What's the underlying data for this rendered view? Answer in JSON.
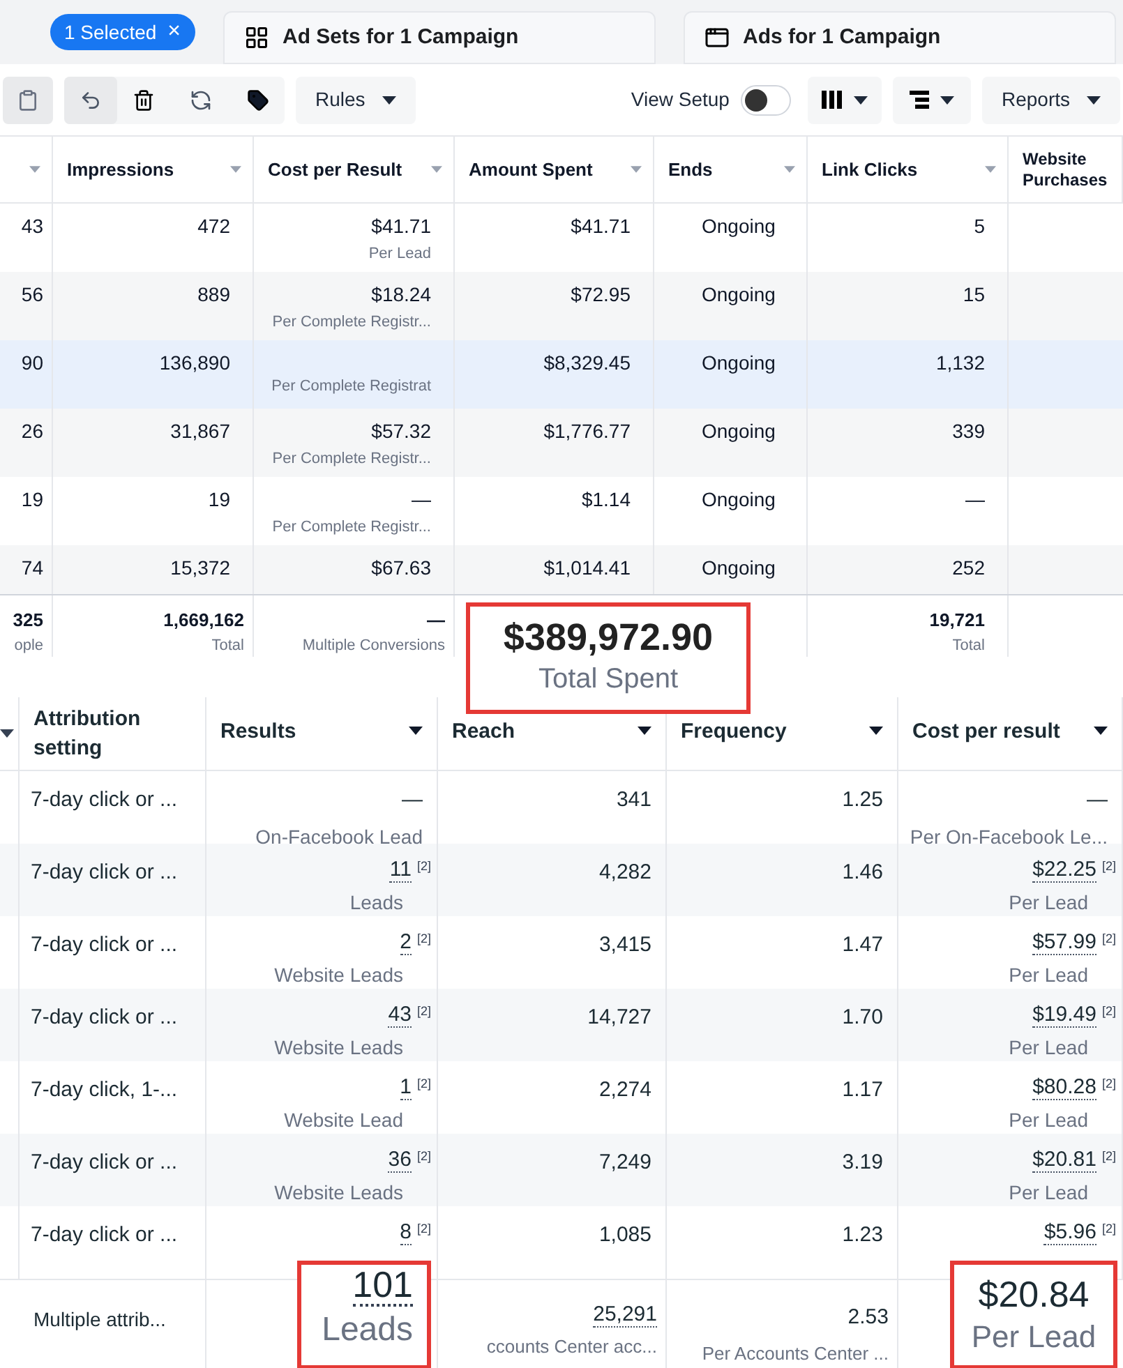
{
  "selection_chip": {
    "label": "1 Selected",
    "close": "×"
  },
  "tabs": [
    {
      "label": "Ad Sets for 1 Campaign",
      "kind": "adsets",
      "selected": false
    },
    {
      "label": "Ads for 1 Campaign",
      "kind": "ads",
      "selected": false
    }
  ],
  "toolbar": {
    "rules": "Rules",
    "view_setup": {
      "label": "View Setup",
      "on": false
    },
    "reports": "Reports"
  },
  "top_table": {
    "columns": [
      "",
      "Impressions",
      "Cost per Result",
      "Amount Spent",
      "Ends",
      "Link Clicks",
      "Website Purchases"
    ],
    "rows": [
      {
        "selected": false,
        "cells": [
          {
            "value": "43"
          },
          {
            "value": "472"
          },
          {
            "value": "$41.71",
            "sub": "Per Lead"
          },
          {
            "value": "$41.71"
          },
          {
            "value": "Ongoing"
          },
          {
            "value": "5"
          }
        ]
      },
      {
        "selected": false,
        "cells": [
          {
            "value": "56"
          },
          {
            "value": "889"
          },
          {
            "value": "$18.24",
            "sub": "Per Complete Registr..."
          },
          {
            "value": "$72.95"
          },
          {
            "value": "Ongoing"
          },
          {
            "value": "15"
          }
        ]
      },
      {
        "selected": true,
        "cells": [
          {
            "value": "90"
          },
          {
            "value": "136,890"
          },
          {
            "sub": "Per Complete Registrat"
          },
          {
            "value": "$8,329.45"
          },
          {
            "value": "Ongoing"
          },
          {
            "value": "1,132"
          }
        ]
      },
      {
        "selected": false,
        "cells": [
          {
            "value": "26"
          },
          {
            "value": "31,867"
          },
          {
            "value": "$57.32",
            "sub": "Per Complete Registr..."
          },
          {
            "value": "$1,776.77"
          },
          {
            "value": "Ongoing"
          },
          {
            "value": "339"
          }
        ]
      },
      {
        "selected": false,
        "cells": [
          {
            "value": "19"
          },
          {
            "value": "19"
          },
          {
            "value": "—",
            "sub": "Per Complete Registr..."
          },
          {
            "value": "$1.14"
          },
          {
            "value": "Ongoing"
          },
          {
            "value": "—"
          }
        ]
      },
      {
        "selected": false,
        "cells": [
          {
            "value": "74"
          },
          {
            "value": "15,372"
          },
          {
            "value": "$67.63"
          },
          {
            "value": "$1,014.41"
          },
          {
            "value": "Ongoing"
          },
          {
            "value": "252"
          }
        ]
      }
    ],
    "footer": [
      {
        "value": "325",
        "sub": "ople"
      },
      {
        "value": "1,669,162",
        "sub": "Total"
      },
      {
        "value": "—",
        "sub": "Multiple Conversions"
      },
      {
        "value": "19,721",
        "sub": "Total"
      }
    ],
    "callout": {
      "value": "$389,972.90",
      "label": "Total Spent"
    }
  },
  "bottom_table": {
    "columns": [
      "Attribution setting",
      "Results",
      "Reach",
      "Frequency",
      "Cost per result"
    ],
    "rows": [
      {
        "cells": [
          {
            "value": "7-day click or ..."
          },
          {
            "value": "—",
            "sub": "On-Facebook Lead"
          },
          {
            "value": "341"
          },
          {
            "value": "1.25"
          },
          {
            "value": "—",
            "sub": "Per On-Facebook Le..."
          }
        ]
      },
      {
        "cells": [
          {
            "value": "7-day click or ..."
          },
          {
            "value": "11",
            "note": "[2]",
            "sub": "Leads"
          },
          {
            "value": "4,282"
          },
          {
            "value": "1.46"
          },
          {
            "value": "$22.25",
            "note": "[2]",
            "sub": "Per Lead"
          }
        ]
      },
      {
        "cells": [
          {
            "value": "7-day click or ..."
          },
          {
            "value": "2",
            "note": "[2]",
            "sub": "Website Leads"
          },
          {
            "value": "3,415"
          },
          {
            "value": "1.47"
          },
          {
            "value": "$57.99",
            "note": "[2]",
            "sub": "Per Lead"
          }
        ]
      },
      {
        "cells": [
          {
            "value": "7-day click or ..."
          },
          {
            "value": "43",
            "note": "[2]",
            "sub": "Website Leads"
          },
          {
            "value": "14,727"
          },
          {
            "value": "1.70"
          },
          {
            "value": "$19.49",
            "note": "[2]",
            "sub": "Per Lead"
          }
        ]
      },
      {
        "cells": [
          {
            "value": "7-day click, 1-..."
          },
          {
            "value": "1",
            "note": "[2]",
            "sub": "Website Lead"
          },
          {
            "value": "2,274"
          },
          {
            "value": "1.17"
          },
          {
            "value": "$80.28",
            "note": "[2]",
            "sub": "Per Lead"
          }
        ]
      },
      {
        "cells": [
          {
            "value": "7-day click or ..."
          },
          {
            "value": "36",
            "note": "[2]",
            "sub": "Website Leads"
          },
          {
            "value": "7,249"
          },
          {
            "value": "3.19"
          },
          {
            "value": "$20.81",
            "note": "[2]",
            "sub": "Per Lead"
          }
        ]
      },
      {
        "cells": [
          {
            "value": "7-day click or ..."
          },
          {
            "value": "8",
            "note": "[2]"
          },
          {
            "value": "1,085"
          },
          {
            "value": "1.23"
          },
          {
            "value": "$5.96",
            "note": "[2]"
          }
        ]
      }
    ],
    "footer": {
      "attribution": "Multiple attrib...",
      "results": {
        "value": "101",
        "label": "Leads"
      },
      "reach": {
        "value": "25,291",
        "sub": "ccounts Center acc..."
      },
      "frequency": {
        "value": "2.53",
        "sub": "Per Accounts Center ..."
      },
      "cost": {
        "value": "$20.84",
        "label": "Per Lead"
      }
    }
  }
}
